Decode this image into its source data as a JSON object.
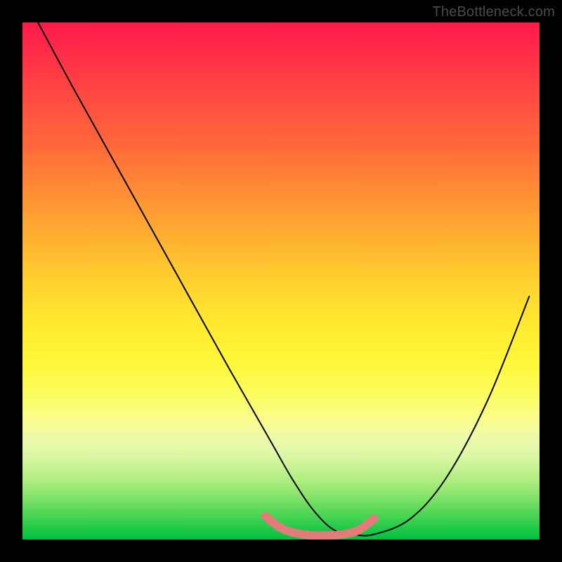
{
  "watermark": "TheBottleneck.com",
  "chart_data": {
    "type": "line",
    "title": "",
    "xlabel": "",
    "ylabel": "",
    "xlim": [
      0,
      100
    ],
    "ylim": [
      0,
      100
    ],
    "grid": false,
    "legend": false,
    "series": [
      {
        "name": "black-curve",
        "color": "#000000",
        "x": [
          3,
          10,
          20,
          30,
          40,
          48,
          52,
          56,
          60,
          64,
          68,
          75,
          82,
          90,
          98
        ],
        "values": [
          100,
          87,
          69,
          51,
          33,
          19,
          12,
          6,
          2,
          1,
          1,
          4,
          12,
          27,
          47
        ]
      },
      {
        "name": "pink-floor-curve",
        "color": "#e47a7a",
        "x": [
          47,
          50,
          53,
          56,
          59,
          62,
          65,
          68
        ],
        "values": [
          4.5,
          2.2,
          1.2,
          0.8,
          0.8,
          1.0,
          1.8,
          4.0
        ]
      }
    ],
    "background_gradient": {
      "direction": "top-to-bottom",
      "stops": [
        {
          "pos": 0,
          "color": "#ff1a4d"
        },
        {
          "pos": 50,
          "color": "#ffd030"
        },
        {
          "pos": 80,
          "color": "#f0fba0"
        },
        {
          "pos": 100,
          "color": "#00c040"
        }
      ]
    }
  }
}
